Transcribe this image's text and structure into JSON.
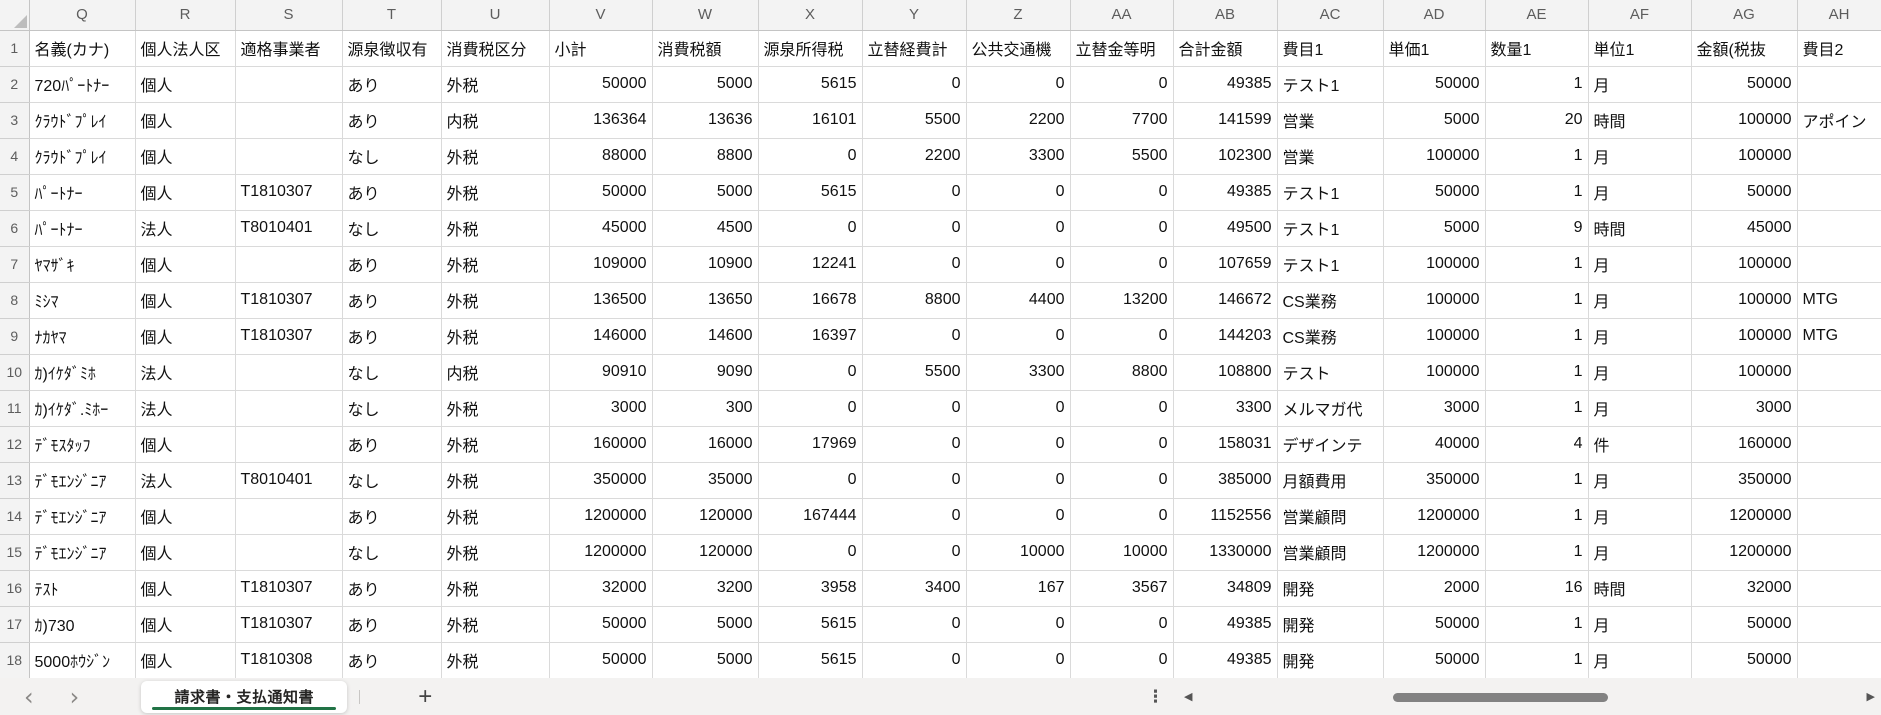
{
  "sheet": {
    "column_letters": [
      "Q",
      "R",
      "S",
      "T",
      "U",
      "V",
      "W",
      "X",
      "Y",
      "Z",
      "AA",
      "AB",
      "AC",
      "AD",
      "AE",
      "AF",
      "AG",
      "AH"
    ],
    "rows": [
      {
        "num": "1",
        "cells": [
          "名義(カナ)",
          "個人法人区",
          "適格事業者",
          "源泉徴収有",
          "消費税区分",
          "小計",
          "消費税額",
          "源泉所得税",
          "立替経費計",
          "公共交通機",
          "立替金等明",
          "合計金額",
          "費目1",
          "単価1",
          "数量1",
          "単位1",
          "金額(税抜",
          "費目2"
        ]
      },
      {
        "num": "2",
        "cells": [
          "720ﾊﾟｰﾄﾅｰ",
          "個人",
          "",
          "あり",
          "外税",
          "50000",
          "5000",
          "5615",
          "0",
          "0",
          "0",
          "49385",
          "テスト1",
          "50000",
          "1",
          "月",
          "50000",
          ""
        ]
      },
      {
        "num": "3",
        "cells": [
          "ｸﾗｳﾄﾞﾌﾟﾚｲ",
          "個人",
          "",
          "あり",
          "内税",
          "136364",
          "13636",
          "16101",
          "5500",
          "2200",
          "7700",
          "141599",
          "営業",
          "5000",
          "20",
          "時間",
          "100000",
          "アポイン"
        ]
      },
      {
        "num": "4",
        "cells": [
          "ｸﾗｳﾄﾞﾌﾟﾚｲ",
          "個人",
          "",
          "なし",
          "外税",
          "88000",
          "8800",
          "0",
          "2200",
          "3300",
          "5500",
          "102300",
          "営業",
          "100000",
          "1",
          "月",
          "100000",
          ""
        ]
      },
      {
        "num": "5",
        "cells": [
          "ﾊﾟｰﾄﾅｰ",
          "個人",
          "T1810307",
          "あり",
          "外税",
          "50000",
          "5000",
          "5615",
          "0",
          "0",
          "0",
          "49385",
          "テスト1",
          "50000",
          "1",
          "月",
          "50000",
          ""
        ]
      },
      {
        "num": "6",
        "cells": [
          "ﾊﾟｰﾄﾅｰ",
          "法人",
          "T8010401",
          "なし",
          "外税",
          "45000",
          "4500",
          "0",
          "0",
          "0",
          "0",
          "49500",
          "テスト1",
          "5000",
          "9",
          "時間",
          "45000",
          ""
        ]
      },
      {
        "num": "7",
        "cells": [
          "ﾔﾏｻﾞｷ",
          "個人",
          "",
          "あり",
          "外税",
          "109000",
          "10900",
          "12241",
          "0",
          "0",
          "0",
          "107659",
          "テスト1",
          "100000",
          "1",
          "月",
          "100000",
          ""
        ]
      },
      {
        "num": "8",
        "cells": [
          "ﾐｼﾏ",
          "個人",
          "T1810307",
          "あり",
          "外税",
          "136500",
          "13650",
          "16678",
          "8800",
          "4400",
          "13200",
          "146672",
          "CS業務",
          "100000",
          "1",
          "月",
          "100000",
          "MTG"
        ]
      },
      {
        "num": "9",
        "cells": [
          "ﾅｶﾔﾏ",
          "個人",
          "T1810307",
          "あり",
          "外税",
          "146000",
          "14600",
          "16397",
          "0",
          "0",
          "0",
          "144203",
          "CS業務",
          "100000",
          "1",
          "月",
          "100000",
          "MTG"
        ]
      },
      {
        "num": "10",
        "cells": [
          "ｶ)ｲｹﾀﾞﾐﾎ",
          "法人",
          "",
          "なし",
          "内税",
          "90910",
          "9090",
          "0",
          "5500",
          "3300",
          "8800",
          "108800",
          "テスト",
          "100000",
          "1",
          "月",
          "100000",
          ""
        ]
      },
      {
        "num": "11",
        "cells": [
          "ｶ)ｲｹﾀﾞ.ﾐﾎｰ",
          "法人",
          "",
          "なし",
          "外税",
          "3000",
          "300",
          "0",
          "0",
          "0",
          "0",
          "3300",
          "メルマガ代",
          "3000",
          "1",
          "月",
          "3000",
          ""
        ]
      },
      {
        "num": "12",
        "cells": [
          "ﾃﾞﾓｽﾀｯﾌ",
          "個人",
          "",
          "あり",
          "外税",
          "160000",
          "16000",
          "17969",
          "0",
          "0",
          "0",
          "158031",
          "デザインテ",
          "40000",
          "4",
          "件",
          "160000",
          ""
        ]
      },
      {
        "num": "13",
        "cells": [
          "ﾃﾞﾓｴﾝｼﾞﾆｱ",
          "法人",
          "T8010401",
          "なし",
          "外税",
          "350000",
          "35000",
          "0",
          "0",
          "0",
          "0",
          "385000",
          "月額費用",
          "350000",
          "1",
          "月",
          "350000",
          ""
        ]
      },
      {
        "num": "14",
        "cells": [
          "ﾃﾞﾓｴﾝｼﾞﾆｱ",
          "個人",
          "",
          "あり",
          "外税",
          "1200000",
          "120000",
          "167444",
          "0",
          "0",
          "0",
          "1152556",
          "営業顧問",
          "1200000",
          "1",
          "月",
          "1200000",
          ""
        ]
      },
      {
        "num": "15",
        "cells": [
          "ﾃﾞﾓｴﾝｼﾞﾆｱ",
          "個人",
          "",
          "なし",
          "外税",
          "1200000",
          "120000",
          "0",
          "0",
          "10000",
          "10000",
          "1330000",
          "営業顧問",
          "1200000",
          "1",
          "月",
          "1200000",
          ""
        ]
      },
      {
        "num": "16",
        "cells": [
          "ﾃｽﾄ",
          "個人",
          "T1810307",
          "あり",
          "外税",
          "32000",
          "3200",
          "3958",
          "3400",
          "167",
          "3567",
          "34809",
          "開発",
          "2000",
          "16",
          "時間",
          "32000",
          ""
        ]
      },
      {
        "num": "17",
        "cells": [
          "ｶ)730",
          "個人",
          "T1810307",
          "あり",
          "外税",
          "50000",
          "5000",
          "5615",
          "0",
          "0",
          "0",
          "49385",
          "開発",
          "50000",
          "1",
          "月",
          "50000",
          ""
        ]
      },
      {
        "num": "18",
        "cells": [
          "5000ﾎｳｼﾞﾝ",
          "個人",
          "T1810308",
          "あり",
          "外税",
          "50000",
          "5000",
          "5615",
          "0",
          "0",
          "0",
          "49385",
          "開発",
          "50000",
          "1",
          "月",
          "50000",
          ""
        ]
      }
    ]
  },
  "tab_bar": {
    "active_tab": "請求書・支払通知書",
    "accent_green": "#217346",
    "icons": {
      "prev": "‹",
      "next": "›",
      "add": "+",
      "more": "⋮",
      "scroll_left": "◀",
      "scroll_right": "▶"
    }
  }
}
